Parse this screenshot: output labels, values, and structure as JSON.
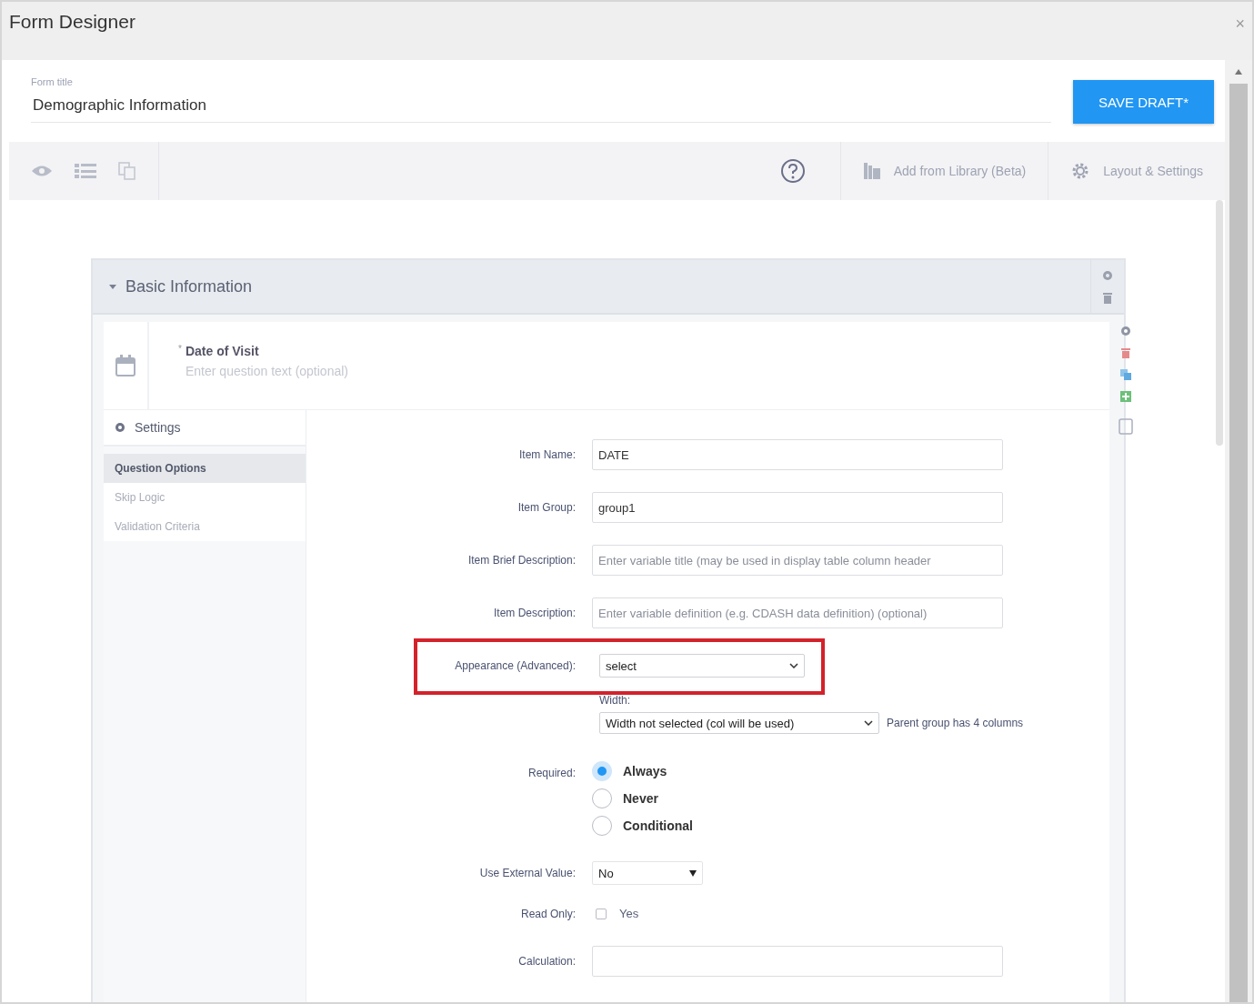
{
  "window": {
    "title": "Form Designer",
    "close": "×"
  },
  "form_title": {
    "label": "Form title",
    "value": "Demographic Information"
  },
  "save_button": "SAVE DRAFT*",
  "toolbar": {
    "actions": [
      {
        "label": "Add from Library (Beta)",
        "kind": "library"
      },
      {
        "label": "Layout & Settings",
        "kind": "settings"
      }
    ]
  },
  "section": {
    "title": "Basic Information",
    "expanded": true
  },
  "question": {
    "required_mark": "*",
    "title": "Date of Visit",
    "placeholder": "Enter question text (optional)"
  },
  "settings": {
    "title": "Settings",
    "items": [
      {
        "label": "Question Options",
        "selected": true
      },
      {
        "label": "Skip Logic",
        "selected": false
      },
      {
        "label": "Validation Criteria",
        "selected": false
      }
    ]
  },
  "fields": [
    {
      "kind": "text",
      "label": "Item Name:",
      "value": "DATE"
    },
    {
      "kind": "text",
      "label": "Item Group:",
      "value": "group1"
    },
    {
      "kind": "text",
      "label": "Item Brief Description:",
      "placeholder": "Enter variable title (may be used in display table column header"
    },
    {
      "kind": "text",
      "label": "Item Description:",
      "placeholder": "Enter variable definition (e.g. CDASH data definition) (optional)"
    },
    {
      "kind": "select",
      "label": "Appearance (Advanced):",
      "value": "select",
      "highlighted": true
    },
    {
      "kind": "width",
      "label": "Width:",
      "value": "Width not selected (col will be used)",
      "note": "Parent group has 4 columns"
    },
    {
      "kind": "radio",
      "label": "Required:",
      "options": [
        {
          "label": "Always",
          "selected": true
        },
        {
          "label": "Never",
          "selected": false
        },
        {
          "label": "Conditional",
          "selected": false
        }
      ]
    },
    {
      "kind": "dropdown",
      "label": "Use External Value:",
      "value": "No"
    },
    {
      "kind": "checkbox",
      "label": "Read Only:",
      "option": "Yes",
      "checked": false
    },
    {
      "kind": "text",
      "label": "Calculation:"
    }
  ]
}
